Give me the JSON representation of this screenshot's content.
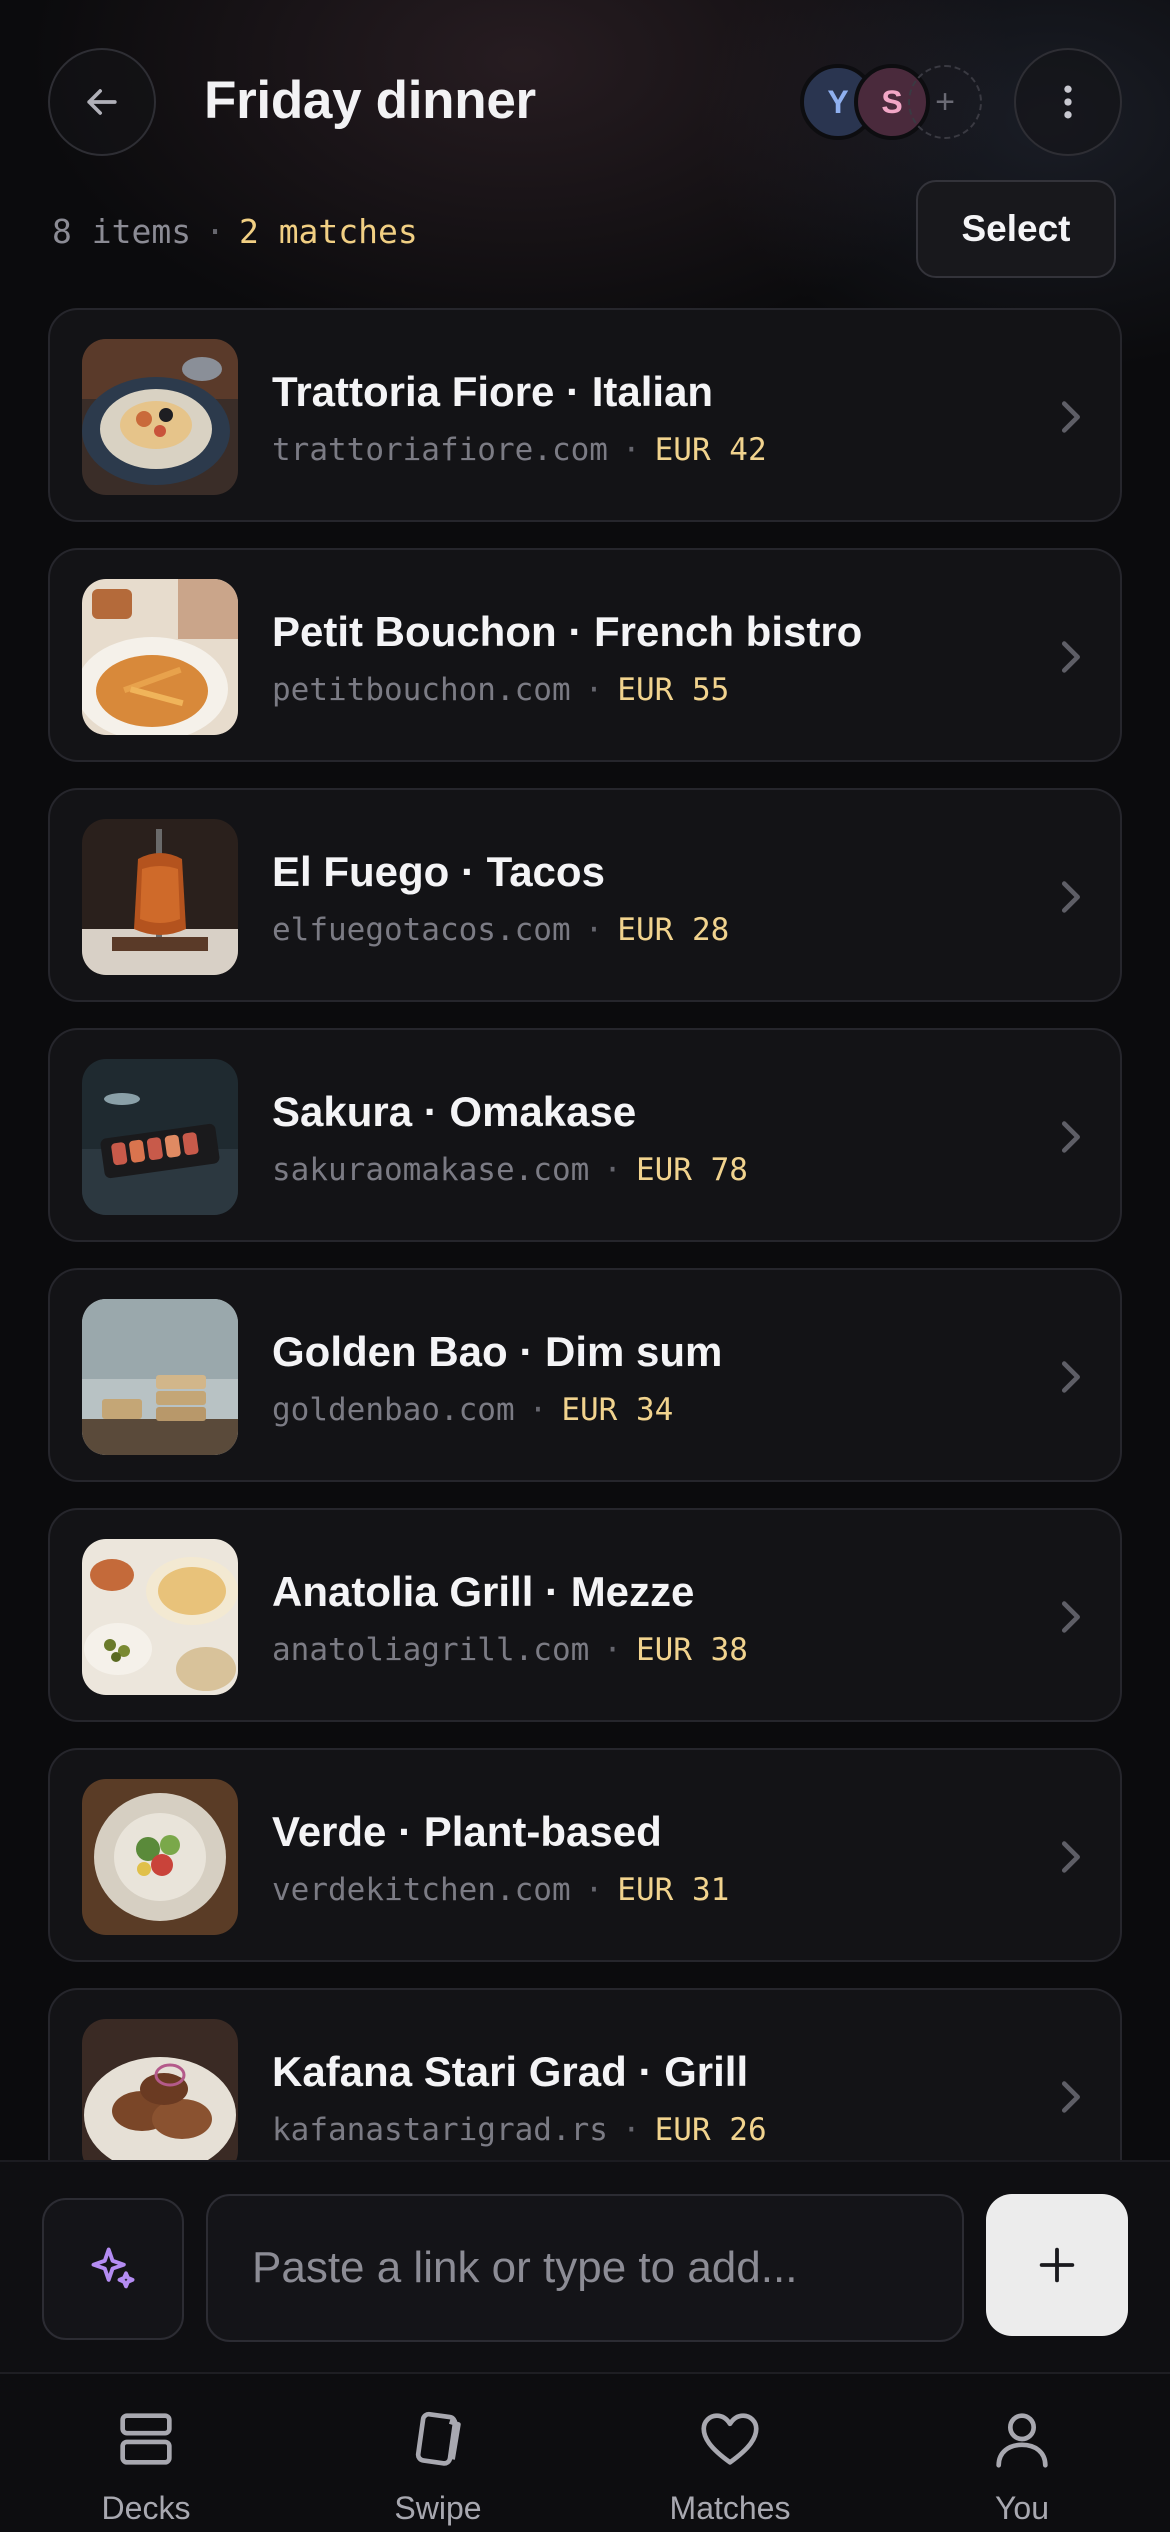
{
  "header": {
    "title": "Friday dinner",
    "avatars": [
      {
        "initial": "Y",
        "color": "#8fb0f0"
      },
      {
        "initial": "S",
        "color": "#f2a6c6"
      }
    ],
    "add_member_symbol": "+"
  },
  "summary": {
    "items": "8 items",
    "separator": "·",
    "matches": "2 matches",
    "select_label": "Select"
  },
  "list": [
    {
      "name": "Trattoria Fiore · Italian",
      "domain": "trattoriafiore.com",
      "price": "EUR 42",
      "thumb": "pasta-plate"
    },
    {
      "name": "Petit Bouchon · French bistro",
      "domain": "petitbouchon.com",
      "price": "EUR 55",
      "thumb": "fries-plate"
    },
    {
      "name": "El Fuego · Tacos",
      "domain": "elfuegotacos.com",
      "price": "EUR 28",
      "thumb": "al-pastor-spit"
    },
    {
      "name": "Sakura · Omakase",
      "domain": "sakuraomakase.com",
      "price": "EUR 78",
      "thumb": "sushi-board"
    },
    {
      "name": "Golden Bao · Dim sum",
      "domain": "goldenbao.com",
      "price": "EUR 34",
      "thumb": "steamer-baskets"
    },
    {
      "name": "Anatolia Grill · Mezze",
      "domain": "anatoliagrill.com",
      "price": "EUR 38",
      "thumb": "mezze-spread"
    },
    {
      "name": "Verde · Plant-based",
      "domain": "verdekitchen.com",
      "price": "EUR 31",
      "thumb": "salad-bowl"
    },
    {
      "name": "Kafana Stari Grad · Grill",
      "domain": "kafanastarigrad.rs",
      "price": "EUR 26",
      "thumb": "grilled-meat"
    }
  ],
  "composer": {
    "placeholder": "Paste a link or type to add...",
    "sparkle_icon": "sparkle-icon",
    "add_icon": "plus-icon"
  },
  "tabs": [
    {
      "label": "Decks",
      "icon": "decks-icon"
    },
    {
      "label": "Swipe",
      "icon": "swipe-icon"
    },
    {
      "label": "Matches",
      "icon": "heart-icon"
    },
    {
      "label": "You",
      "icon": "person-icon"
    }
  ],
  "colors": {
    "accent_gold": "#f1d38e",
    "sparkle_purple": "#b48cf2",
    "background": "#0b0b0d"
  }
}
